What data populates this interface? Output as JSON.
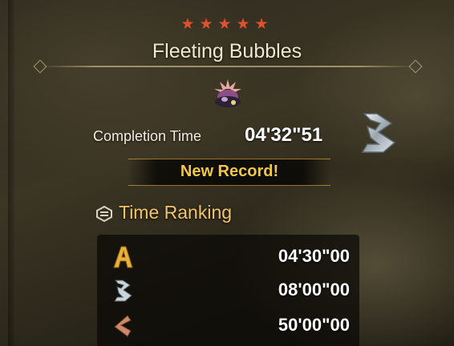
{
  "quest": {
    "stars": "★★★★★",
    "title": "Fleeting Bubbles"
  },
  "result": {
    "completion_label": "Completion Time",
    "completion_value": "04'32\"51",
    "rank": "B",
    "record_text": "New Record!"
  },
  "ranking": {
    "title": "Time Ranking",
    "rows": [
      {
        "rank": "A",
        "time": "04'30\"00"
      },
      {
        "rank": "B",
        "time": "08'00\"00"
      },
      {
        "rank": "C",
        "time": "50'00\"00"
      }
    ]
  },
  "colors": {
    "star": "#e0512e",
    "record": "#f2c84a",
    "ranking_title": "#f1c46c",
    "rank_a": "#e8b23a",
    "rank_b": "#c9d3da",
    "rank_c": "#c98a6a"
  },
  "icons": {
    "monster": "monster-icon",
    "ranking": "ranking-emblem-icon"
  }
}
